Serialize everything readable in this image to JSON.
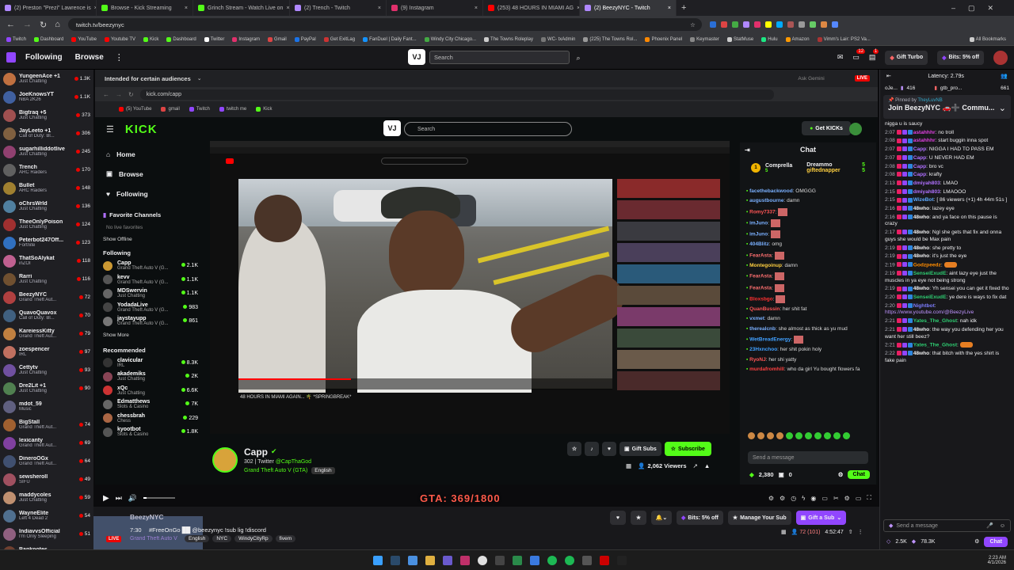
{
  "browser_tabs": [
    "(2) Preston \"Prezi\" Lawrence is",
    "Browse - Kick Streaming",
    "Grinch Stream - Watch Live on",
    "(2) Trench - Twitch",
    "(9) Instagram",
    "(253) 48 HOURS IN MIAMI AG",
    "(2) BeezyNYC - Twitch"
  ],
  "tab_colors": [
    "#b088ff",
    "#53fc18",
    "#53fc18",
    "#b088ff",
    "#e1306c",
    "#ff0000",
    "#b088ff"
  ],
  "url": "twitch.tv/beezynyc",
  "bookmarks": [
    "Twitch",
    "Dashboard",
    "YouTube",
    "Youtube TV",
    "Kick",
    "Dashboard",
    "Twitter",
    "Instagram",
    "Gmail",
    "PayPal",
    "Get ExitLag",
    "FanDuel | Daily Fant...",
    "Windy City Chicago...",
    "The Towns Roleplay",
    "WC- txAdmin",
    "(225) The Towns Rol...",
    "Phoenix Panel",
    "Keymaster",
    "StatMuse",
    "Hulu",
    "Amazon",
    "Vimm's Lair: PS2 Va...",
    "All Bookmarks"
  ],
  "twitch_nav": {
    "following": "Following",
    "browse": "Browse",
    "search_placeholder": "Search",
    "gift_turbo": "Gift Turbo",
    "bits": "Bits: 5% off",
    "notif1": "1",
    "notif2": "12"
  },
  "sidebar": [
    {
      "name": "YungeenAce +1",
      "game": "Just Chatting",
      "viewers": "1.3K",
      "color": "#c07040"
    },
    {
      "name": "JoeKnowsYT",
      "game": "NBA 2K26",
      "viewers": "1.1K",
      "color": "#4060a0"
    },
    {
      "name": "Bigtraq +5",
      "game": "Just Chatting",
      "viewers": "373",
      "color": "#a05050"
    },
    {
      "name": "JayLeeto +1",
      "game": "Call of Duty: Bl...",
      "viewers": "306",
      "color": "#806040"
    },
    {
      "name": "sugarhilliddotlive",
      "game": "Just Chatting",
      "viewers": "245",
      "color": "#904070"
    },
    {
      "name": "Trench",
      "game": "ARC Raiders",
      "viewers": "170",
      "color": "#606060"
    },
    {
      "name": "Bullet",
      "game": "ARC Raiders",
      "viewers": "148",
      "color": "#a08030"
    },
    {
      "name": "oChrsWrld",
      "game": "Just Chatting",
      "viewers": "136",
      "color": "#5080a0"
    },
    {
      "name": "TheeOnlyPoison",
      "game": "Just Chatting",
      "viewers": "124",
      "color": "#a03030"
    },
    {
      "name": "Peterbot247Off...",
      "game": "Fortnite",
      "viewers": "123",
      "color": "#3070c0"
    },
    {
      "name": "ThatSoAlykat",
      "game": "inZOI",
      "viewers": "118",
      "color": "#c06090"
    },
    {
      "name": "Rarri",
      "game": "Just Chatting",
      "viewers": "116",
      "color": "#705030"
    },
    {
      "name": "BeezyNYC",
      "game": "Grand Theft Aut...",
      "viewers": "72",
      "color": "#b04040"
    },
    {
      "name": "QuavoQuavox",
      "game": "Call of Duty: Bl...",
      "viewers": "70",
      "color": "#406080"
    },
    {
      "name": "KareiessKitty",
      "game": "Grand Theft Aut...",
      "viewers": "79",
      "color": "#c08040"
    },
    {
      "name": "zoespencer",
      "game": "IRL",
      "viewers": "97",
      "color": "#c07060"
    },
    {
      "name": "Cettytv",
      "game": "Just Chatting",
      "viewers": "93",
      "color": "#7050a0"
    },
    {
      "name": "Dre2Lit +1",
      "game": "Just Chatting",
      "viewers": "90",
      "color": "#508050"
    },
    {
      "name": "mdot_59",
      "game": "Music",
      "viewers": "",
      "color": "#606080"
    },
    {
      "name": "BigStall",
      "game": "Grand Theft Aut...",
      "viewers": "74",
      "color": "#a06030"
    },
    {
      "name": "lexicanty",
      "game": "Grand Theft Aut...",
      "viewers": "69",
      "color": "#8040a0"
    },
    {
      "name": "DineroOGx",
      "game": "Grand Theft Aut...",
      "viewers": "64",
      "color": "#405070"
    },
    {
      "name": "sewsheroll",
      "game": "SIFU",
      "viewers": "49",
      "color": "#a05060"
    },
    {
      "name": "maddycoles",
      "game": "Just Chatting",
      "viewers": "59",
      "color": "#c09070"
    },
    {
      "name": "WayneElite",
      "game": "Left 4 Dead 2",
      "viewers": "54",
      "color": "#507090"
    },
    {
      "name": "IndiavvsOfficial",
      "game": "I'm Only Sleeping",
      "viewers": "51",
      "color": "#906080"
    },
    {
      "name": "Banknotes",
      "game": "Dead by Daylight",
      "viewers": "50",
      "color": "#704030"
    }
  ],
  "inner": {
    "audience_label": "Intended for certain audiences",
    "ask_gemini": "Ask Gemini",
    "live": "LIVE",
    "url": "kick.com/capp",
    "bookmarks": [
      "(5) YouTube",
      "gmail",
      "Twitch",
      "twitch me",
      "Kick"
    ]
  },
  "kick": {
    "logo": "KICK",
    "search_placeholder": "Search",
    "get_kicks": "Get KICKs",
    "nav": [
      "Home",
      "Browse",
      "Following"
    ],
    "favorite_header": "Favorite Channels",
    "no_favs": "No live favorites",
    "show_offline": "Show Offline",
    "following_header": "Following",
    "following": [
      {
        "name": "Capp",
        "game": "Grand Theft Auto V (G...",
        "viewers": "2.1K"
      },
      {
        "name": "kevv",
        "game": "Grand Theft Auto V (G...",
        "viewers": "1.1K"
      },
      {
        "name": "MDSwervin",
        "game": "Just Chatting",
        "viewers": "1.1K"
      },
      {
        "name": "YodadaLive",
        "game": "Grand Theft Auto V (G...",
        "viewers": "983"
      },
      {
        "name": "jaystayupp",
        "game": "Grand Theft Auto V (G...",
        "viewers": "861"
      }
    ],
    "show_more": "Show More",
    "recommended_header": "Recommended",
    "recommended": [
      {
        "name": "clavicular",
        "game": "IRL",
        "viewers": "8.3K"
      },
      {
        "name": "akademiks",
        "game": "Just Chatting",
        "viewers": "2K"
      },
      {
        "name": "xQc",
        "game": "Just Chatting",
        "viewers": "6.6K"
      },
      {
        "name": "Edmatthews",
        "game": "Slots & Casino",
        "viewers": "7K"
      },
      {
        "name": "chessbrah",
        "game": "Chess",
        "viewers": "229"
      },
      {
        "name": "kyootbot",
        "game": "Slots & Casino",
        "viewers": "1.8K"
      }
    ],
    "streamer": "Capp",
    "followers": "302 | Twitter",
    "twitter_handle": "@CapThaGod",
    "category": "Grand Theft Auto V (GTA)",
    "language": "English",
    "gift_subs": "Gift Subs",
    "subscribe": "Subscribe",
    "viewers": "2,062 Viewers",
    "chat_title": "Chat",
    "top_gifters": [
      "Comprella",
      "Dreammo",
      "giftednapper"
    ],
    "gifter_counts": [
      "5",
      "5",
      "5"
    ],
    "chat": [
      {
        "u": "facethebackwood",
        "m": "OMGGG",
        "c": "#7ab0ff"
      },
      {
        "u": "augustbourne",
        "m": "damn",
        "c": "#7ab0ff"
      },
      {
        "u": "Romy7337",
        "m": "",
        "c": "#ff5555"
      },
      {
        "u": "imJuno",
        "m": "",
        "c": "#7ab0ff"
      },
      {
        "u": "imJuno",
        "m": "",
        "c": "#7ab0ff"
      },
      {
        "u": "404Blitz",
        "m": "omg",
        "c": "#7ab0ff"
      },
      {
        "u": "FearAsta",
        "m": "",
        "c": "#ff7070"
      },
      {
        "u": "Montegoinup",
        "m": "damn",
        "c": "#ffd040"
      },
      {
        "u": "FearAsta",
        "m": "",
        "c": "#ff7070"
      },
      {
        "u": "FearAsta",
        "m": "",
        "c": "#ff7070"
      },
      {
        "u": "Bloxsbgo",
        "m": "",
        "c": "#ff3030"
      },
      {
        "u": "QuanBussin",
        "m": "her shit fat",
        "c": "#ff5555"
      },
      {
        "u": "vxmet",
        "m": "damn",
        "c": "#7ab0ff"
      },
      {
        "u": "therealcnb",
        "m": "she almost as thick as yu mud",
        "c": "#7ab0ff"
      },
      {
        "u": "WetBreadEnergy",
        "m": "",
        "c": "#40a0ff"
      },
      {
        "u": "23Hxnchoo",
        "m": "her shit pokin holy",
        "c": "#40a0ff"
      },
      {
        "u": "RyoNJ",
        "m": "her shi yatty",
        "c": "#ff5555"
      },
      {
        "u": "murdafromhill",
        "m": "who da girl Yu bought flowers fa",
        "c": "#ff4040"
      }
    ],
    "send_placeholder": "Send a message",
    "balance": "2,380",
    "kicks": "0",
    "chat_button": "Chat"
  },
  "stream_overlay": {
    "title": "GTA: 369/1800"
  },
  "stream_info": {
    "streamer": "BeezyNYC",
    "time": "7:30",
    "title": "#FreeOnGo ██ @beezynyc !sub lig !discord",
    "category": "Grand Theft Auto V",
    "tags": [
      "English",
      "NYC",
      "WindyCityRp",
      "fivem"
    ],
    "viewers": "72 (101)",
    "uptime": "4:52:47",
    "bits": "Bits: 5% off",
    "manage_sub": "Manage Your Sub",
    "gift_sub": "Gift a Sub"
  },
  "twitch_chat": {
    "latency": "Latency: 2.79s",
    "viewer_pin_count": "416",
    "gtb_label": "gtb_pro...",
    "gtb_count": "661",
    "pinned_by": "Pinned by",
    "pinned_user": "TheyLuvNB",
    "pinned_text": "Join BeezyNYC 🚗➕ Commu...",
    "messages": [
      {
        "t": "",
        "u": "",
        "m": "nigga u is saucy",
        "c": "#efeff1"
      },
      {
        "t": "2:07",
        "u": "astahhhr",
        "m": "no troll",
        "c": "#e040e0"
      },
      {
        "t": "2:08",
        "u": "astahhhr",
        "m": "start buggin inna spot",
        "c": "#e040e0"
      },
      {
        "t": "2:07",
        "u": "Capp",
        "m": "NIGGA I HAD TO PASS EM",
        "c": "#b070ff"
      },
      {
        "t": "2:07",
        "u": "Capp",
        "m": "U NEVER HAD EM",
        "c": "#b070ff"
      },
      {
        "t": "2:08",
        "u": "Capp",
        "m": "bro vc",
        "c": "#b070ff"
      },
      {
        "t": "2:08",
        "u": "Capp",
        "m": "krafty",
        "c": "#b070ff"
      },
      {
        "t": "2:13",
        "u": "dmiyah803",
        "m": "LMAO",
        "c": "#b070ff"
      },
      {
        "t": "2:15",
        "u": "dmiyah803",
        "m": "LMAOOO",
        "c": "#b070ff"
      },
      {
        "t": "2:15",
        "u": "WizeBot",
        "m": "[ 86 viewers (+1) 4h 44m 51s ]",
        "c": "#5eaaff"
      },
      {
        "t": "2:16",
        "u": "48who",
        "m": "lazey eye",
        "c": "#efeff1"
      },
      {
        "t": "2:16",
        "u": "48who",
        "m": "and ya face on this pause is crazy",
        "c": "#efeff1"
      },
      {
        "t": "2:17",
        "u": "48who",
        "m": "Ngl she gets that fix and onna guys she would be Max pain",
        "c": "#efeff1"
      },
      {
        "t": "2:19",
        "u": "48who",
        "m": "she pretty to",
        "c": "#efeff1"
      },
      {
        "t": "2:19",
        "u": "48who",
        "m": "it's just the eye",
        "c": "#efeff1"
      },
      {
        "t": "2:19",
        "u": "Godzpeedz",
        "m": "",
        "c": "#ff8c00"
      },
      {
        "t": "2:19",
        "u": "SenseiExudE",
        "m": "aint lazy eye just the muscles in ya eye not being strong",
        "c": "#2ecc71"
      },
      {
        "t": "2:19",
        "u": "48who",
        "m": "Yh sensei you can get it fixed tho",
        "c": "#efeff1"
      },
      {
        "t": "2:20",
        "u": "SenseiExudE",
        "m": "ye dere is ways to fix dat",
        "c": "#2ecc71"
      },
      {
        "t": "2:20",
        "u": "Nightbot",
        "m": "https://www.youtube.com/@BeezyLive",
        "c": "#7d7dff"
      },
      {
        "t": "2:21",
        "u": "Yates_The_Ghost",
        "m": "nah idk",
        "c": "#2ecc71"
      },
      {
        "t": "2:21",
        "u": "48who",
        "m": "the way you defending her you want her still beez?",
        "c": "#efeff1"
      },
      {
        "t": "2:21",
        "u": "Yates_The_Ghost",
        "m": "",
        "c": "#2ecc71"
      },
      {
        "t": "2:22",
        "u": "48who",
        "m": "that bitch with the yes shirt is fake pain",
        "c": "#efeff1"
      }
    ],
    "send_placeholder": "Send a message",
    "points": "2.5K",
    "bits_count": "78.3K",
    "chat_button": "Chat"
  },
  "taskbar": {
    "time": "2:23 AM",
    "date": "4/1/2026"
  }
}
